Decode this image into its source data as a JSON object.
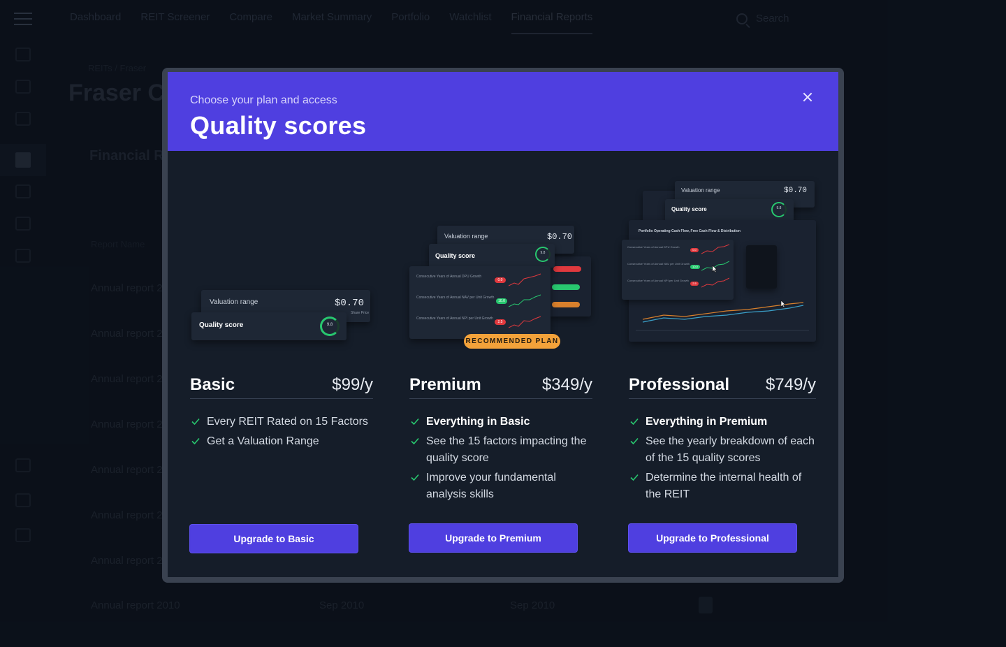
{
  "app": {
    "nav_tabs": [
      "Dashboard",
      "REIT Screener",
      "Compare",
      "Market Summary",
      "Portfolio",
      "Watchlist",
      "Financial Reports"
    ],
    "search_label": "Search",
    "breadcrumb": "REITs / Fraser",
    "page_title": "Fraser C",
    "section_title": "Financial R",
    "column_header": "Report Name",
    "rows": [
      {
        "name": "Annual report 2",
        "d1": "",
        "d2": ""
      },
      {
        "name": "Annual report 2",
        "d1": "",
        "d2": ""
      },
      {
        "name": "Annual report 2",
        "d1": "",
        "d2": ""
      },
      {
        "name": "Annual report 2",
        "d1": "",
        "d2": ""
      },
      {
        "name": "Annual report 2",
        "d1": "",
        "d2": ""
      },
      {
        "name": "Annual report 2",
        "d1": "",
        "d2": ""
      },
      {
        "name": "Annual report 2",
        "d1": "",
        "d2": ""
      },
      {
        "name": "Annual report 2010",
        "d1": "Sep 2010",
        "d2": "Sep 2010"
      }
    ]
  },
  "modal": {
    "subtitle": "Choose your plan and access",
    "title": "Quality scores",
    "art": {
      "valuation_label": "Valuation range",
      "valuation_value": "$0.70",
      "share_price_hint": "Share Price",
      "quality_label": "Quality score",
      "score": "9.8",
      "metric_1": "Consecutive Years of Annual DPU Growth",
      "metric_2": "Consecutive Years of Annual NAV per Unit Growth",
      "metric_3": "Consecutive Years of Annual NPI per Unit Growth",
      "pill_1": "0.0",
      "pill_2": "10.0",
      "pill_3": "2.5",
      "chart_caption": "Portfolio Operating Cash Flow, Free Cash Flow & Distribution",
      "recommended_badge": "RECOMMENDED PLAN"
    },
    "plans": [
      {
        "name": "Basic",
        "price": "$99/y",
        "features": [
          "Every REIT Rated on 15 Factors",
          "Get a Valuation Range"
        ],
        "button": "Upgrade to Basic"
      },
      {
        "name": "Premium",
        "price": "$349/y",
        "features": [
          "Everything in Basic",
          "See the 15 factors impacting the quality score",
          "Improve your fundamental analysis skills"
        ],
        "button": "Upgrade to Premium"
      },
      {
        "name": "Professional",
        "price": "$749/y",
        "features": [
          "Everything in Premium",
          "See the yearly breakdown of each of the 15 quality scores",
          "Determine the internal health of the REIT"
        ],
        "button": "Upgrade to Professional"
      }
    ]
  },
  "colors": {
    "accent": "#4f3fe0",
    "check": "#28c76f",
    "badge": "#f3a23a",
    "danger": "#e0393e"
  }
}
